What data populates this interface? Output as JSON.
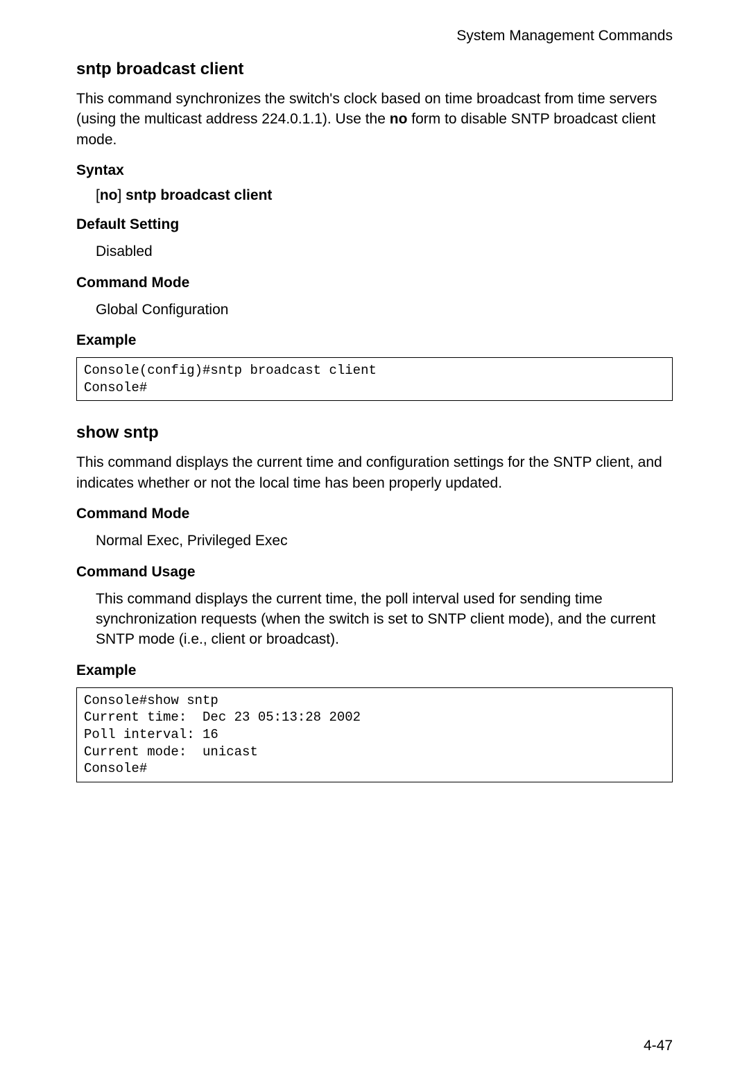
{
  "header": {
    "label": "System Management Commands"
  },
  "section1": {
    "title": "sntp broadcast client",
    "description_part1": "This command synchronizes the switch's clock based on time broadcast from time servers (using the multicast address 224.0.1.1). Use the ",
    "description_bold": "no",
    "description_part2": " form to disable SNTP broadcast client mode.",
    "syntax_heading": "Syntax",
    "syntax_bracket_open": "[",
    "syntax_no": "no",
    "syntax_bracket_close": "]",
    "syntax_cmd": " sntp broadcast client",
    "default_heading": "Default Setting",
    "default_value": "Disabled",
    "mode_heading": "Command Mode",
    "mode_value": "Global Configuration",
    "example_heading": "Example",
    "example_code": "Console(config)#sntp broadcast client\nConsole#"
  },
  "section2": {
    "title": "show sntp",
    "description": "This command displays the current time and configuration settings for the SNTP client, and indicates whether or not the local time has been properly updated.",
    "mode_heading": "Command Mode",
    "mode_value": "Normal Exec, Privileged Exec",
    "usage_heading": "Command Usage",
    "usage_text": "This command displays the current time, the poll interval used for sending time synchronization requests (when the switch is set to SNTP client mode), and the current SNTP mode (i.e., client or broadcast).",
    "example_heading": "Example",
    "example_code": "Console#show sntp\nCurrent time:  Dec 23 05:13:28 2002\nPoll interval: 16\nCurrent mode:  unicast\nConsole#"
  },
  "footer": {
    "page": "4-47"
  }
}
